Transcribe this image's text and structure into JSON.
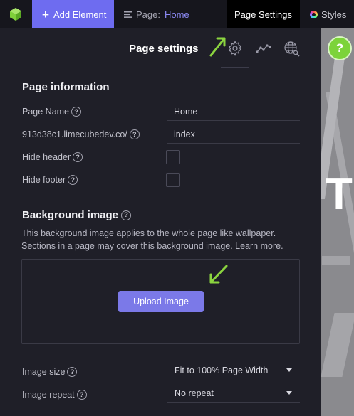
{
  "topbar": {
    "add_element": "Add Element",
    "page_prefix": "Page:",
    "page_name": "Home",
    "tab_page_settings": "Page Settings",
    "tab_styles": "Styles"
  },
  "panel": {
    "title": "Page settings"
  },
  "page_info": {
    "heading": "Page information",
    "page_name_label": "Page Name",
    "page_name_value": "Home",
    "url_label": "913d38c1.limecubedev.co/",
    "url_value": "index",
    "hide_header_label": "Hide header",
    "hide_footer_label": "Hide footer"
  },
  "background": {
    "heading": "Background image",
    "description": "This background image applies to the whole page like wallpaper. Sections in a page may cover this background image. Learn more.",
    "upload_label": "Upload Image",
    "image_size_label": "Image size",
    "image_size_value": "Fit to 100% Page Width",
    "image_repeat_label": "Image repeat",
    "image_repeat_value": "No repeat"
  },
  "help_glyph": "?",
  "preview_letter": "T",
  "colors": {
    "accent": "#6e6cf0",
    "arrow": "#8bd43f",
    "help_fab": "#7cd33a"
  }
}
